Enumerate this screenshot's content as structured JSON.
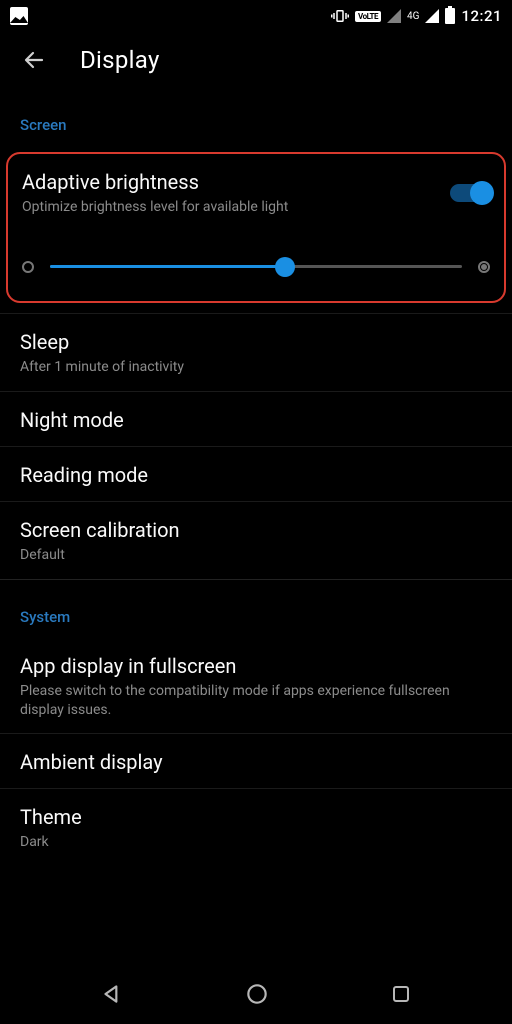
{
  "status": {
    "time": "12:21",
    "volte": "VoLTE",
    "network_label": "4G"
  },
  "header": {
    "title": "Display"
  },
  "sections": {
    "screen": "Screen",
    "system": "System"
  },
  "brightness": {
    "title": "Adaptive brightness",
    "subtitle": "Optimize brightness level for available light",
    "toggle_on": true,
    "slider_percent": 57
  },
  "rows": {
    "sleep": {
      "title": "Sleep",
      "subtitle": "After 1 minute of inactivity"
    },
    "night_mode": {
      "title": "Night mode"
    },
    "reading_mode": {
      "title": "Reading mode"
    },
    "screen_cal": {
      "title": "Screen calibration",
      "subtitle": "Default"
    },
    "app_fullscreen": {
      "title": "App display in fullscreen",
      "subtitle": "Please switch to the compatibility mode if apps experience fullscreen display issues."
    },
    "ambient": {
      "title": "Ambient display"
    },
    "theme": {
      "title": "Theme",
      "subtitle": "Dark"
    }
  }
}
